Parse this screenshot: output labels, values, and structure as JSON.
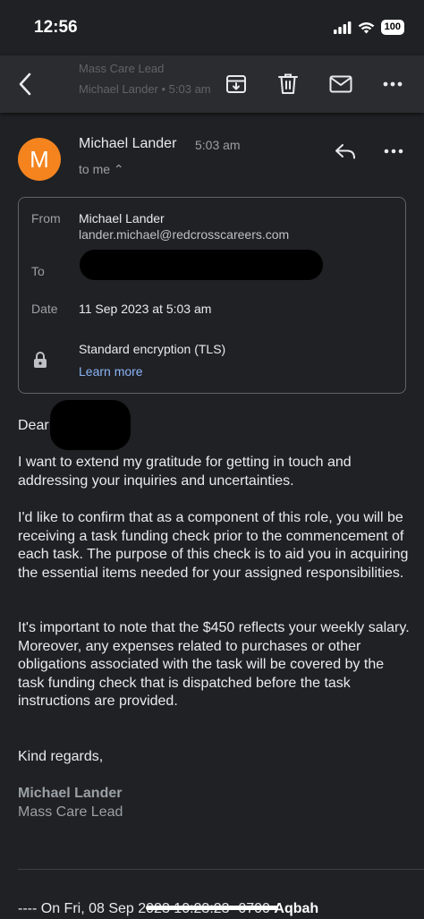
{
  "status_bar": {
    "time": "12:56",
    "battery": "100",
    "signal_icon": "signal-bars-icon",
    "wifi_icon": "wifi-icon"
  },
  "toolbar": {
    "icons": [
      "back-arrow-icon",
      "archive-icon",
      "delete-icon",
      "mark-unread-icon",
      "more-vert-icon"
    ],
    "ghost_line1": "Mass Care Lead",
    "ghost_line2": "Michael Lander • 5:03 am"
  },
  "message": {
    "avatar_letter": "M",
    "avatar_color": "#f5841f",
    "sender": "Michael Lander",
    "time": "5:03 am",
    "recipient_summary": "to me ⌃"
  },
  "details": {
    "from_label": "From",
    "from_name": "Michael Lander",
    "from_email": "lander.michael@redcrosscareers.com",
    "to_label": "To",
    "date_label": "Date",
    "date_value": "11 Sep 2023 at 5:03 am",
    "security": "Standard encryption (TLS)",
    "learn_more": "Learn more"
  },
  "body": {
    "greeting": "Dear",
    "p1": "I want to extend my gratitude for getting in touch and addressing your inquiries and uncertainties.",
    "p2": "I'd like to confirm that as a component of this role, you will be receiving a task funding check prior to the commencement of each task. The purpose of this check is to aid you in acquiring the essential items needed for your assigned responsibilities.",
    "p3": "It's important to note that the $450 reflects your weekly salary. Moreover, any expenses related to purchases or other obligations associated with the task will be covered by the task funding check that is dispatched before the task instructions are provided.",
    "closing": "Kind regards,",
    "signature_name": "Michael Lander",
    "signature_title": "Mass Care Lead"
  },
  "quoted": {
    "prefix": "---- On Fri, 08 Sep 2023 10:23:23 -0700",
    "name": "Aqbah"
  }
}
